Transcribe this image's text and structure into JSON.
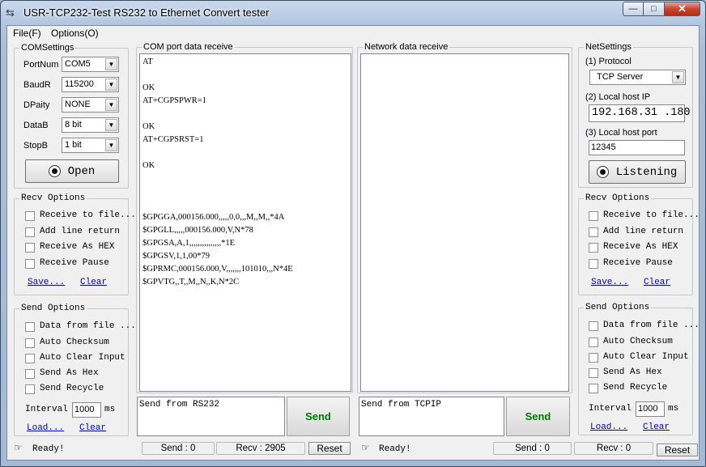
{
  "window": {
    "title": "USR-TCP232-Test  RS232 to Ethernet Convert tester",
    "caption_min": "—",
    "caption_max": "□",
    "caption_close": "✕"
  },
  "menu": {
    "file": "File(F)",
    "options": "Options(O)"
  },
  "com_settings": {
    "title": "COMSettings",
    "port_label": "PortNum",
    "port_value": "COM5",
    "baud_label": "BaudR",
    "baud_value": "115200",
    "parity_label": "DPaity",
    "parity_value": "NONE",
    "databits_label": "DataB",
    "databits_value": "8 bit",
    "stopbits_label": "StopB",
    "stopbits_value": "1 bit",
    "open_button": "Open"
  },
  "left_recv_options": {
    "title": "Recv Options",
    "items": [
      "Receive to file...",
      "Add line return",
      "Receive As HEX",
      "Receive Pause"
    ],
    "save_link": "Save...",
    "clear_link": "Clear"
  },
  "left_send_options": {
    "title": "Send Options",
    "items": [
      "Data from file ...",
      "Auto Checksum",
      "Auto Clear Input",
      "Send As Hex",
      "Send Recycle"
    ],
    "interval_label": "Interval",
    "interval_value": "1000",
    "interval_unit": "ms",
    "load_link": "Load...",
    "clear_link": "Clear"
  },
  "com_receive": {
    "title": "COM port data receive",
    "lines": [
      "AT",
      "",
      "OK",
      "AT+CGPSPWR=1",
      "",
      "OK",
      "AT+CGPSRST=1",
      "",
      "OK",
      "",
      "",
      "",
      "$GPGGA,000156.000,,,,,0,0,,,M,,M,,*4A",
      "$GPGLL,,,,,000156.000,V,N*78",
      "$GPGSA,A,1,,,,,,,,,,,,,,,*1E",
      "$GPGSV,1,1,00*79",
      "$GPRMC,000156.000,V,,,,,,,101010,,,N*4E",
      "$GPVTG,,T,,M,,N,,K,N*2C"
    ]
  },
  "network_receive": {
    "title": "Network data receive"
  },
  "com_send": {
    "text": "Send from RS232",
    "button": "Send"
  },
  "net_send": {
    "text": "Send from TCPIP",
    "button": "Send"
  },
  "net_settings": {
    "title": "NetSettings",
    "protocol_label": "(1) Protocol",
    "protocol_value": "TCP Server",
    "ip_label": "(2) Local host IP",
    "ip_value": "192.168.31 .180",
    "port_label": "(3) Local host port",
    "port_value": "12345",
    "listen_button": "Listening"
  },
  "right_recv_options": {
    "title": "Recv Options",
    "items": [
      "Receive to file...",
      "Add line return",
      "Receive As HEX",
      "Receive Pause"
    ],
    "save_link": "Save...",
    "clear_link": "Clear"
  },
  "right_send_options": {
    "title": "Send Options",
    "items": [
      "Data from file ...",
      "Auto Checksum",
      "Auto Clear Input",
      "Send As Hex",
      "Send Recycle"
    ],
    "interval_label": "Interval",
    "interval_value": "1000",
    "interval_unit": "ms",
    "load_link": "Load...",
    "clear_link": "Clear"
  },
  "status": {
    "left_ready": "Ready!",
    "com_send_count": "Send : 0",
    "com_recv_count": "Recv : 2905",
    "com_reset": "Reset",
    "right_ready": "Ready!",
    "net_send_count": "Send : 0",
    "net_recv_count": "Recv : 0",
    "net_reset": "Reset"
  },
  "icons": {
    "app": "serial-plug-icon",
    "status_left": "pointing-hand-icon",
    "status_right": "pointing-hand-icon"
  },
  "colors": {
    "send_button_text": "#007a00",
    "link": "#0000cc",
    "close_button": "#c8442d"
  }
}
